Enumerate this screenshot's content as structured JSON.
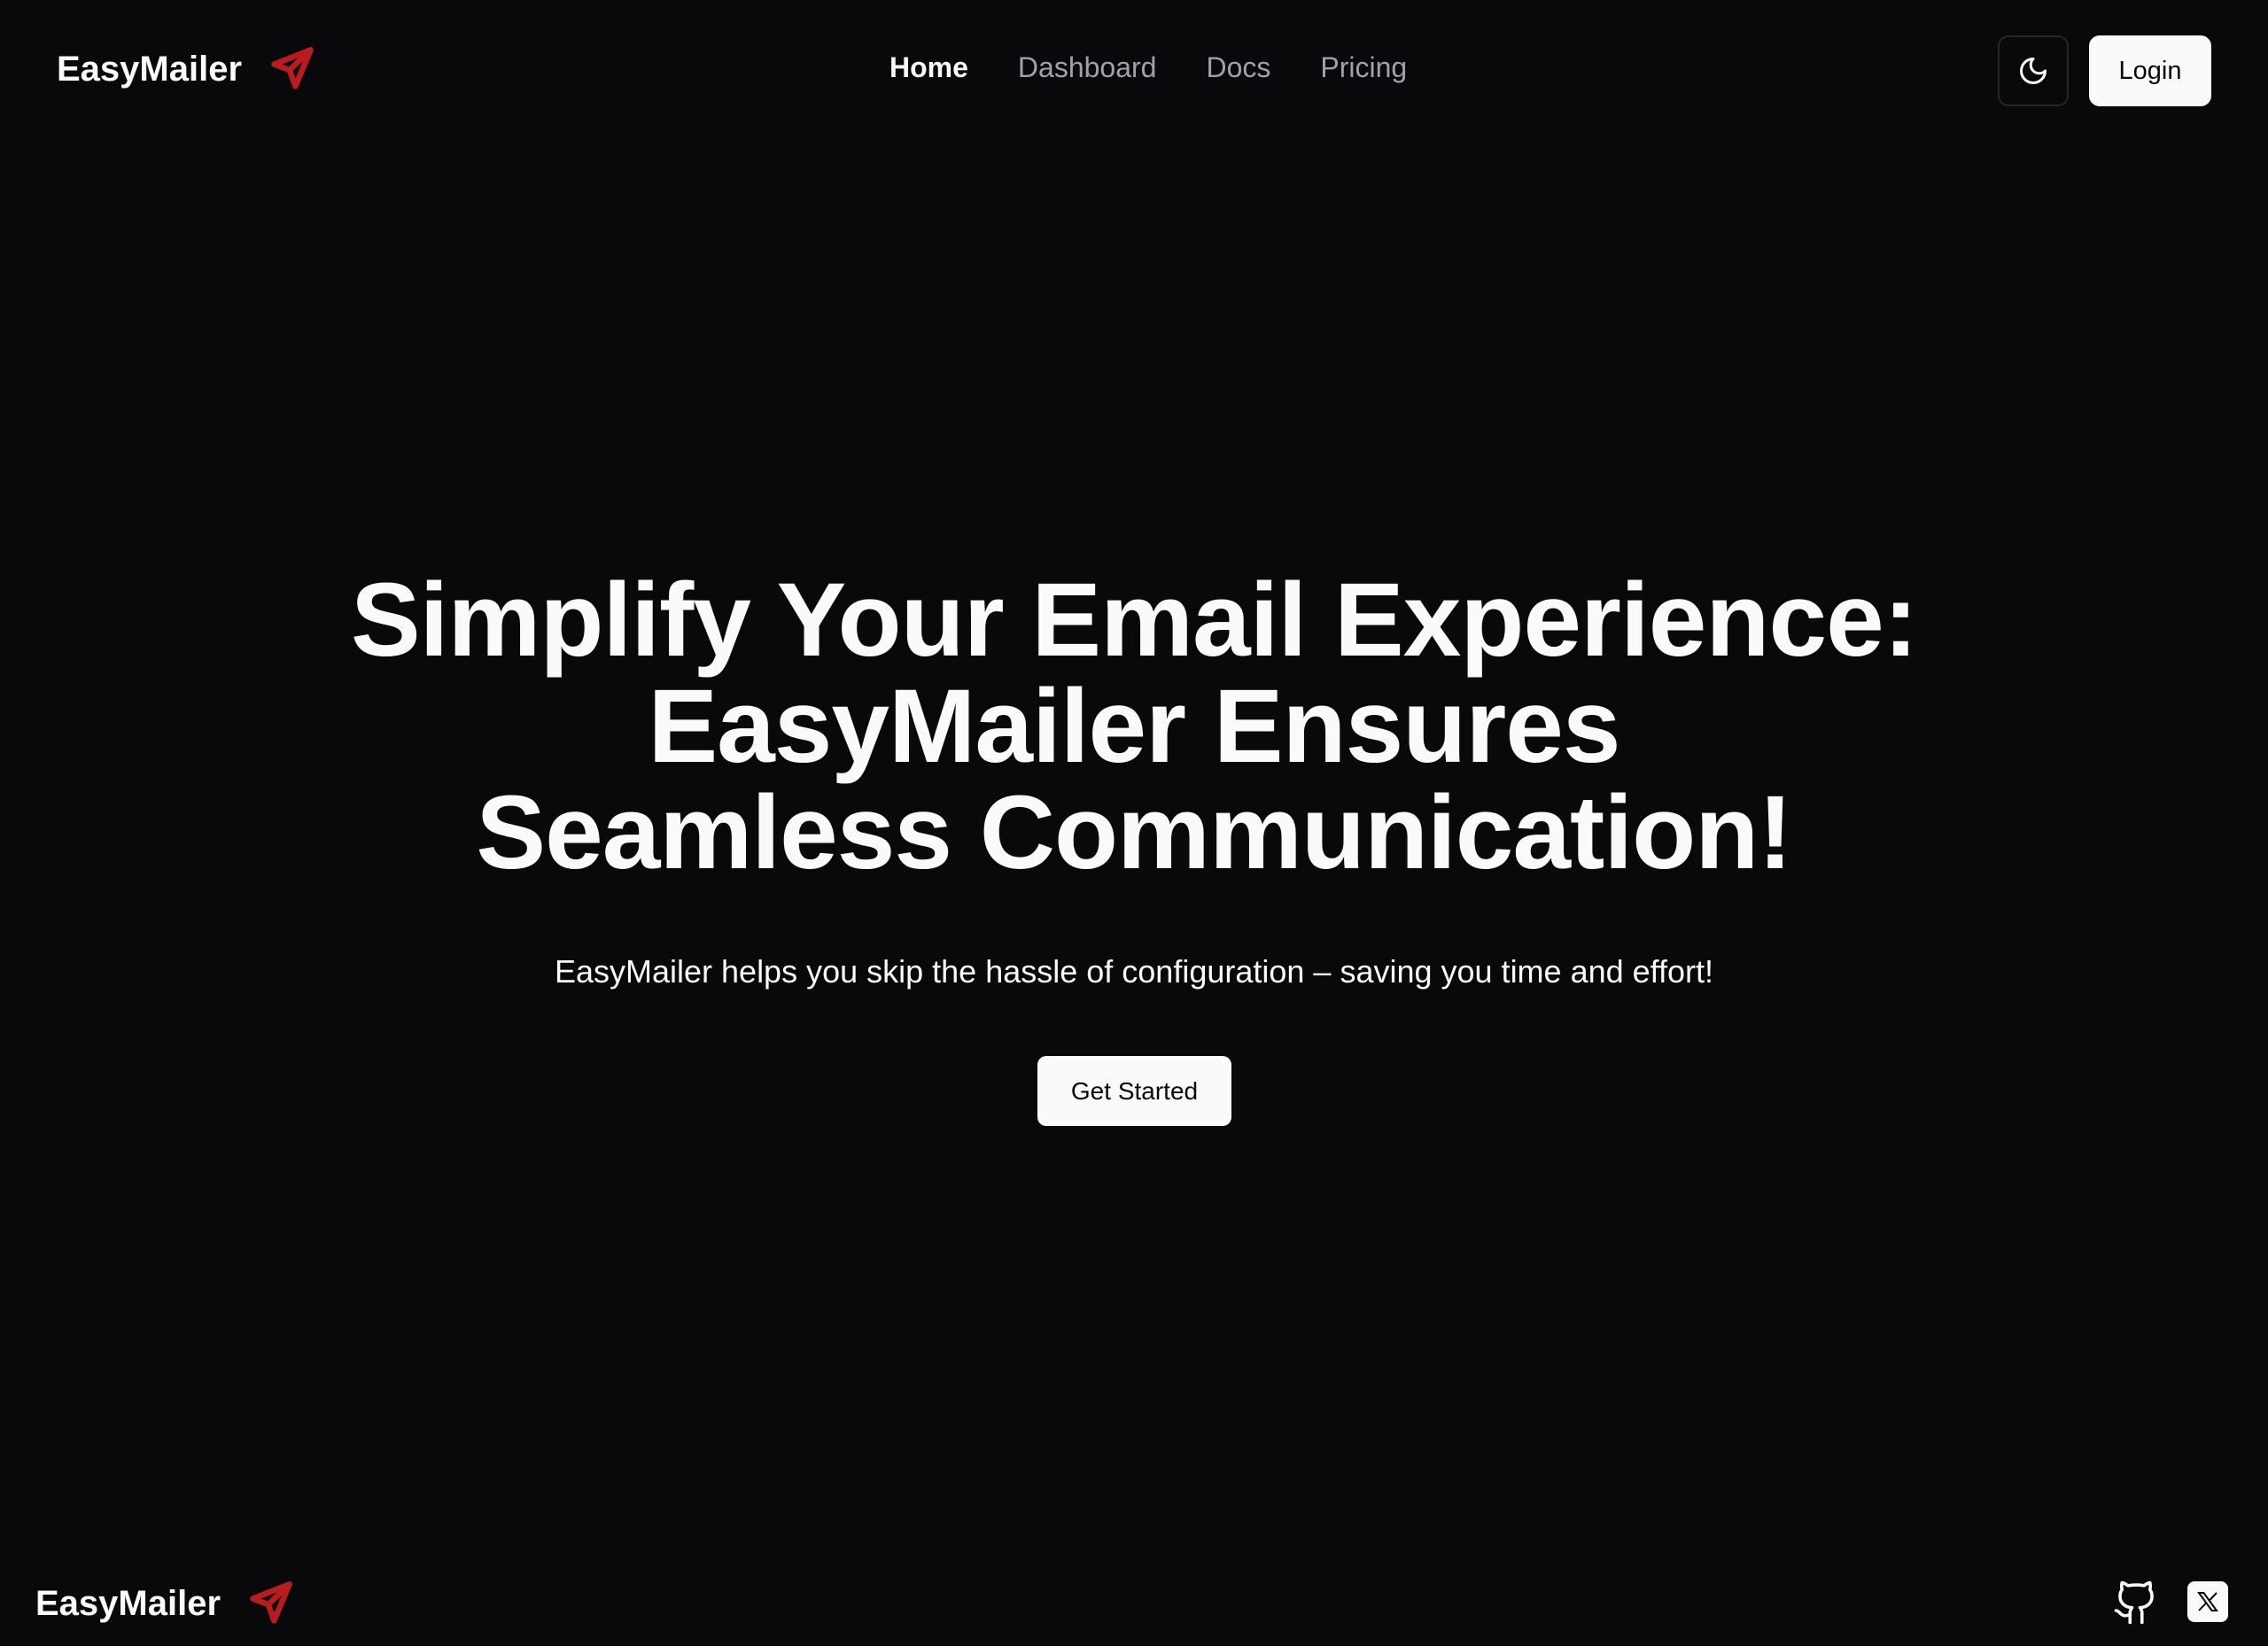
{
  "brand": "EasyMailer",
  "nav": {
    "items": [
      "Home",
      "Dashboard",
      "Docs",
      "Pricing"
    ]
  },
  "header": {
    "login_label": "Login"
  },
  "hero": {
    "title_lines": [
      "Simplify Your Email Experience:",
      "EasyMailer Ensures",
      "Seamless Communication!"
    ],
    "subtitle": "EasyMailer helps you skip the hassle of configuration – saving you time and effort!",
    "cta_label": "Get Started"
  },
  "colors": {
    "background": "#09090b",
    "accent": "#b91c1c",
    "foreground": "#fafafa",
    "muted": "#a1a1aa"
  }
}
